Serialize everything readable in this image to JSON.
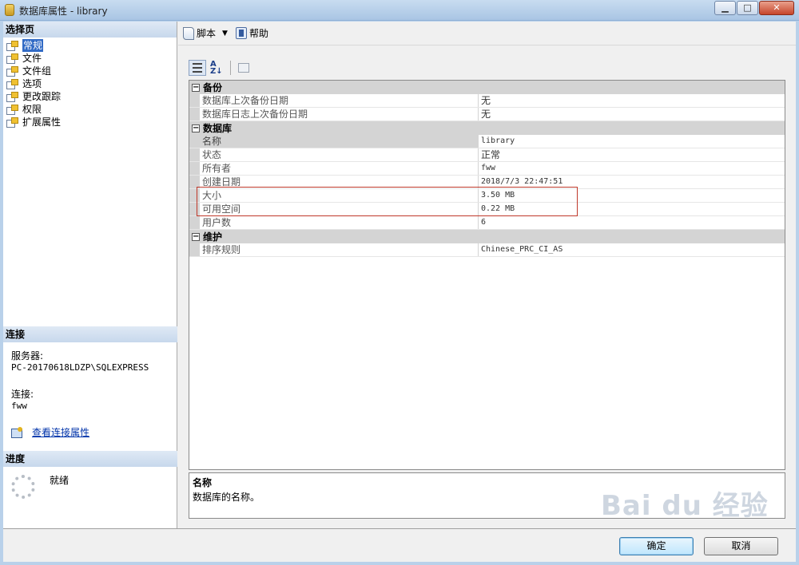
{
  "window": {
    "title": "数据库属性 - library",
    "minimize": "▁",
    "maximize": "□",
    "close": "✕"
  },
  "left": {
    "select_page_header": "选择页",
    "pages": [
      {
        "label": "常规",
        "selected": true
      },
      {
        "label": "文件"
      },
      {
        "label": "文件组"
      },
      {
        "label": "选项"
      },
      {
        "label": "更改跟踪"
      },
      {
        "label": "权限"
      },
      {
        "label": "扩展属性"
      }
    ],
    "connection_header": "连接",
    "server_label": "服务器:",
    "server_value": "PC-20170618LDZP\\SQLEXPRESS",
    "connection_label": "连接:",
    "connection_value": "fww",
    "view_connection_link": "查看连接属性",
    "progress_header": "进度",
    "progress_status": "就绪"
  },
  "toolbar": {
    "script_label": "脚本",
    "help_label": "帮助"
  },
  "grid": {
    "categories": [
      {
        "name": "备份",
        "rows": [
          {
            "name": "数据库上次备份日期",
            "value": "无"
          },
          {
            "name": "数据库日志上次备份日期",
            "value": "无"
          }
        ]
      },
      {
        "name": "数据库",
        "rows": [
          {
            "name": "名称",
            "value": "library"
          },
          {
            "name": "状态",
            "value": "正常"
          },
          {
            "name": "所有者",
            "value": "fww"
          },
          {
            "name": "创建日期",
            "value": "2018/7/3 22:47:51"
          },
          {
            "name": "大小",
            "value": "3.50 MB"
          },
          {
            "name": "可用空间",
            "value": "0.22 MB"
          },
          {
            "name": "用户数",
            "value": "6"
          }
        ]
      },
      {
        "name": "维护",
        "rows": [
          {
            "name": "排序规则",
            "value": "Chinese_PRC_CI_AS"
          }
        ]
      }
    ]
  },
  "description": {
    "title": "名称",
    "text": "数据库的名称。"
  },
  "buttons": {
    "ok": "确定",
    "cancel": "取消"
  },
  "watermark": "Bai du 经验"
}
